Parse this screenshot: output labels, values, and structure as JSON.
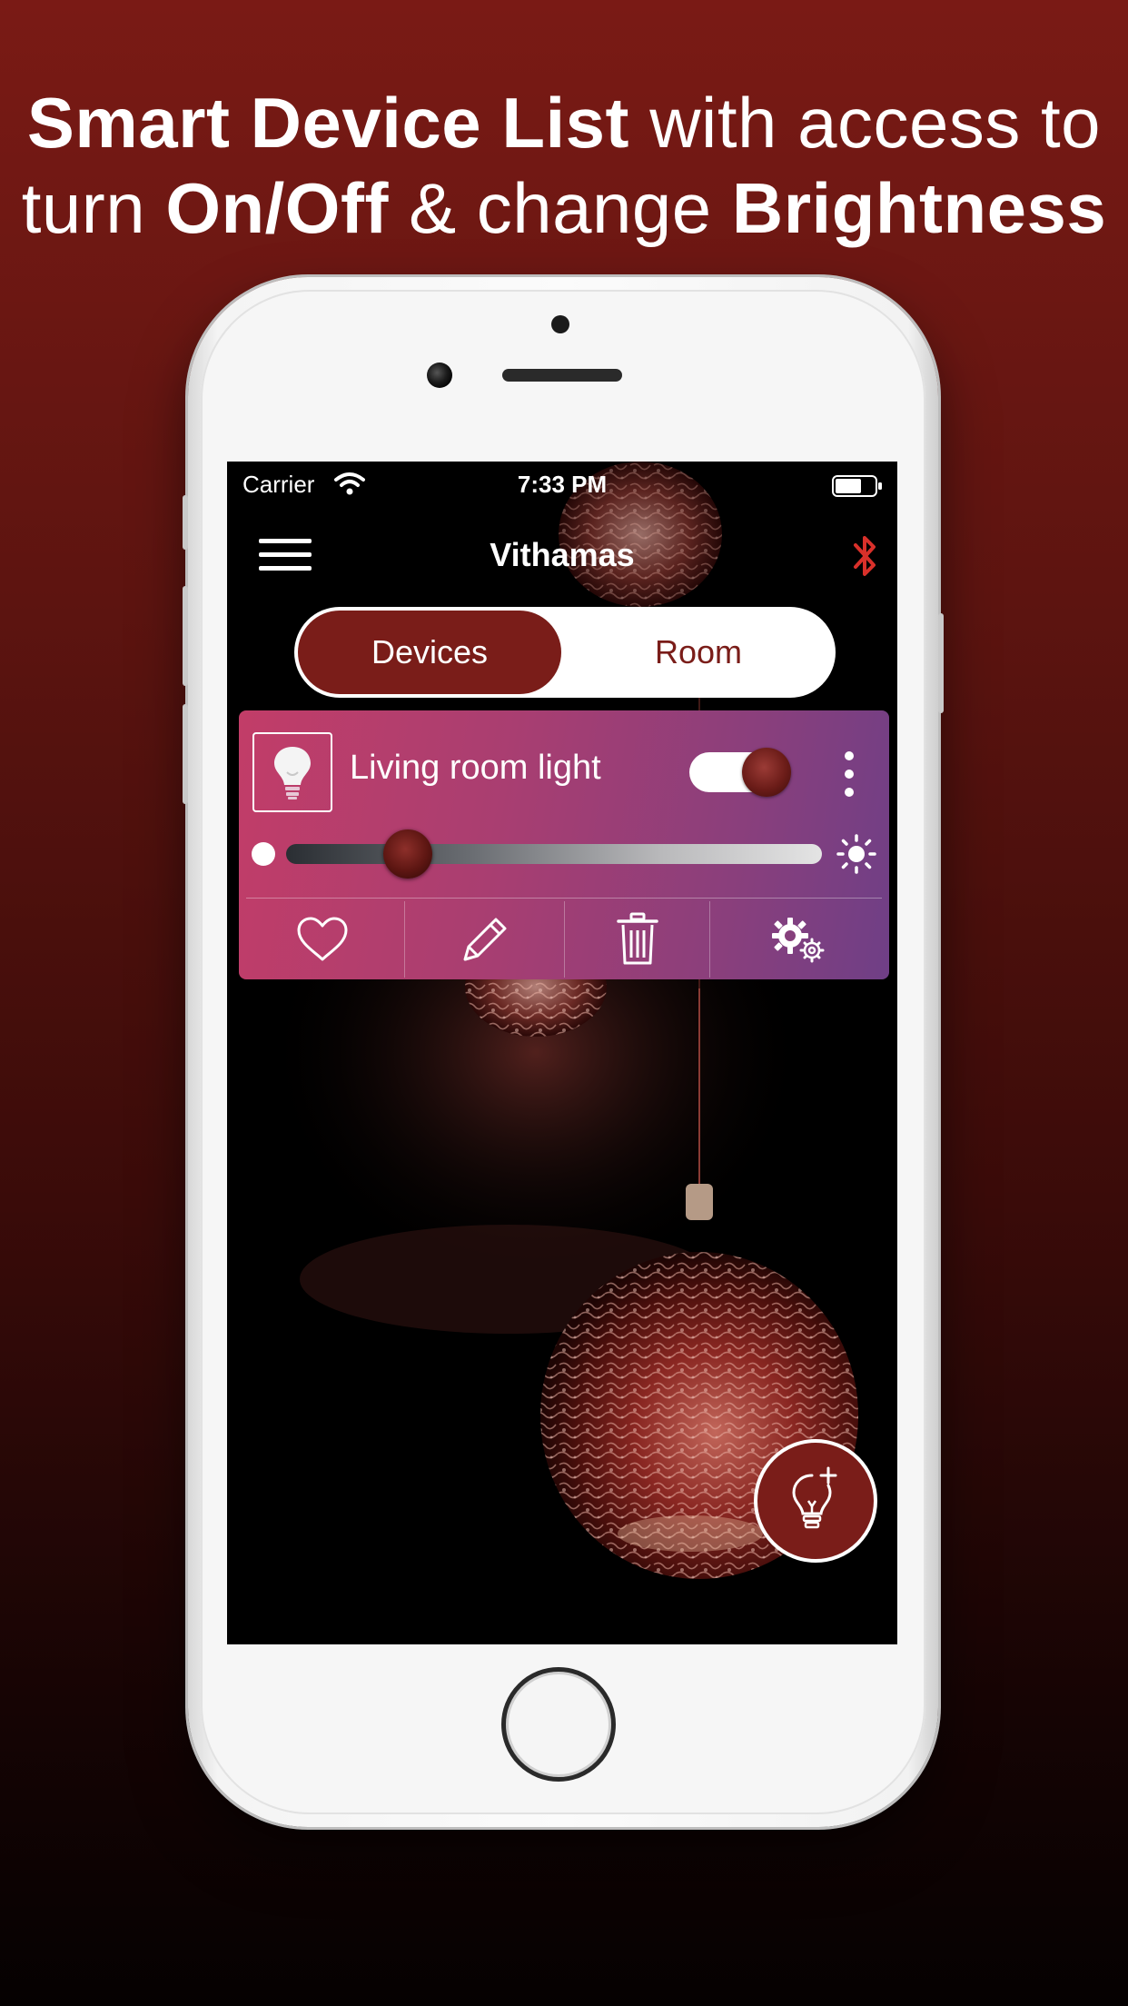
{
  "headline": {
    "line1_bold": "Smart Device List",
    "line1_normal": " with access to",
    "line2_normal_a": "turn ",
    "line2_bold_a": "On/Off",
    "line2_normal_b": " & change ",
    "line2_bold_b": "Brightness"
  },
  "status_bar": {
    "carrier": "Carrier",
    "time": "7:33 PM",
    "icons": [
      "wifi-icon",
      "battery-icon"
    ]
  },
  "nav": {
    "title": "Vithamas",
    "left_icon": "menu-icon",
    "right_icon": "bluetooth-icon",
    "bluetooth_color": "#d9302a"
  },
  "segment": {
    "options": [
      "Devices",
      "Room"
    ],
    "selected": "Devices"
  },
  "device": {
    "name": "Living room light",
    "icon": "bulb-icon",
    "power_on": true,
    "brightness_fraction": 0.2,
    "menu_icon": "more-vertical-icon",
    "actions": [
      {
        "name": "favorite",
        "icon": "heart-icon"
      },
      {
        "name": "edit",
        "icon": "pencil-icon"
      },
      {
        "name": "delete",
        "icon": "trash-icon"
      },
      {
        "name": "settings",
        "icon": "gears-icon"
      }
    ]
  },
  "fab": {
    "icon": "add-bulb-icon"
  },
  "colors": {
    "accent": "#7a1d19",
    "card_start": "#c23d68",
    "card_end": "#6f3f86"
  }
}
